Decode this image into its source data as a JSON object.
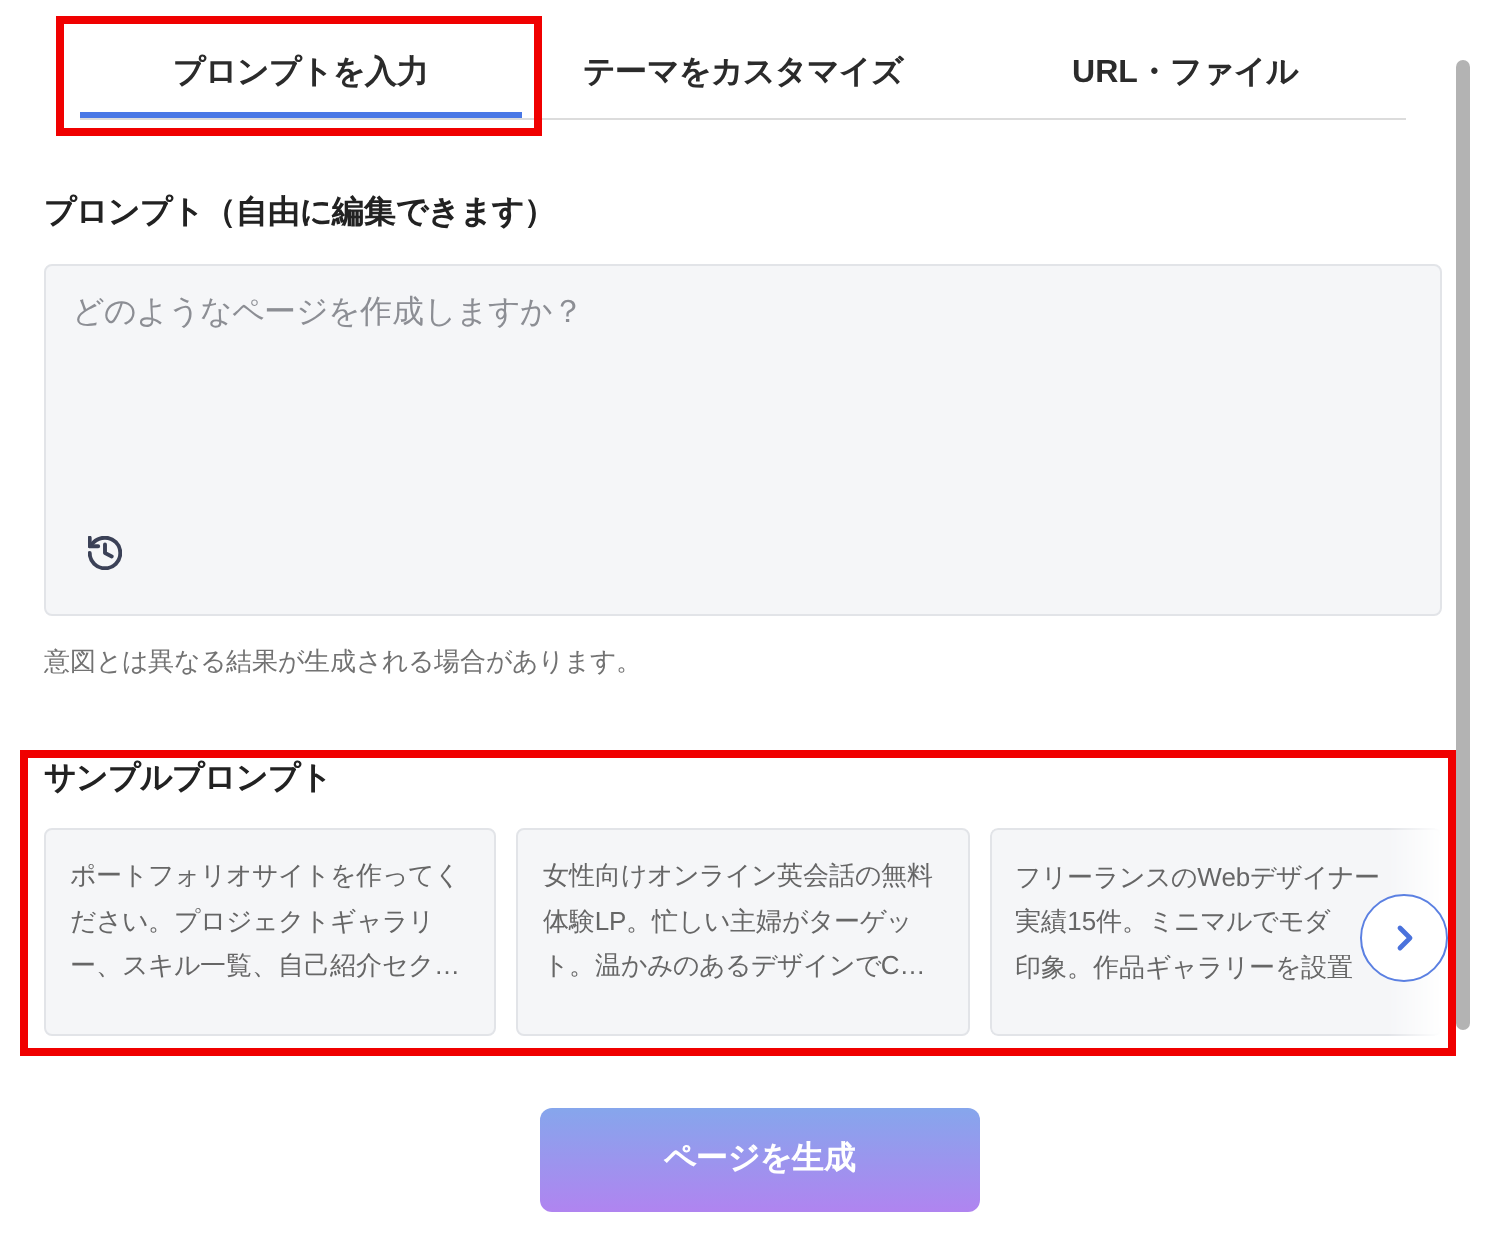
{
  "tabs": [
    {
      "label": "プロンプトを入力",
      "selected": true,
      "highlighted": true
    },
    {
      "label": "テーマをカスタマイズ",
      "selected": false,
      "highlighted": false
    },
    {
      "label": "URL・ファイル",
      "selected": false,
      "highlighted": false
    }
  ],
  "prompt": {
    "label": "プロンプト（自由に編集できます）",
    "placeholder": "どのようなページを作成しますか？",
    "note": "意図とは異なる結果が生成される場合があります。"
  },
  "samples": {
    "title": "サンプルプロンプト",
    "highlighted": true,
    "cards": [
      {
        "kind": "paragraph",
        "text": "ポートフォリオサイトを作ってください。プロジェクトギャラリー、スキル一覧、自己紹介セク…"
      },
      {
        "kind": "paragraph",
        "text": "女性向けオンライン英会話の無料体験LP。忙しい主婦がターゲット。温かみのあるデザインでC…"
      },
      {
        "kind": "clipped",
        "lines": [
          "フリーランスのWebデザイナー",
          "実績15件。ミニマルでモダ",
          "印象。作品ギャラリーを設置"
        ]
      }
    ]
  },
  "generate_button": {
    "label": "ページを生成",
    "disabled": true
  }
}
